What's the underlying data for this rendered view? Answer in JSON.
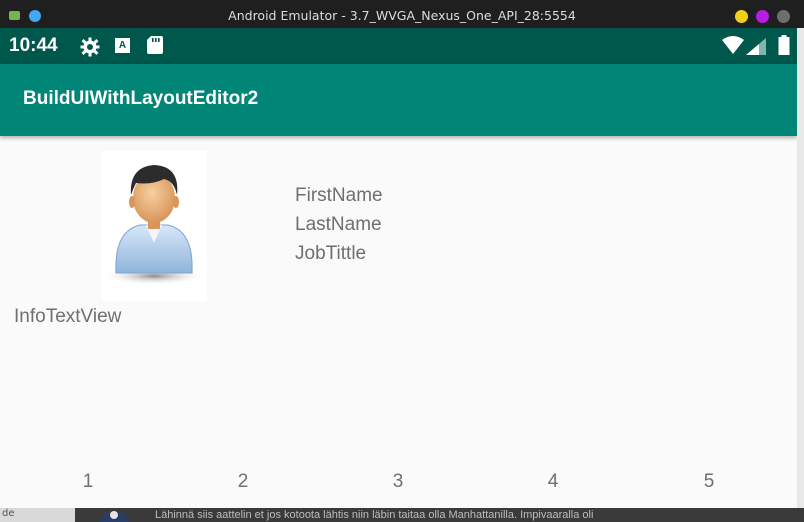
{
  "window": {
    "title": "Android Emulator - 3.7_WVGA_Nexus_One_API_28:5554"
  },
  "statusbar": {
    "time": "10:44",
    "icons": [
      "gear-icon",
      "a-icon",
      "sd-card-icon",
      "wifi-icon",
      "signal-icon",
      "battery-icon"
    ],
    "a_label": "A"
  },
  "appbar": {
    "title": "BuildUIWithLayoutEditor2"
  },
  "profile": {
    "avatar_icon": "person-avatar-icon",
    "first_name": "FirstName",
    "last_name": "LastName",
    "job_title": "JobTittle"
  },
  "info_text": "InfoTextView",
  "numbers": [
    "1",
    "2",
    "3",
    "4",
    "5"
  ],
  "background_window": {
    "left_text": "de",
    "text": "Lähinnä siis aattelin et jos kotoota lähtis niin läbin taitaa olla Manhattanilla. Impivaaralla oli"
  },
  "colors": {
    "status_bar": "#00574b",
    "app_bar": "#008577",
    "body_text": "#6f6f6f"
  }
}
